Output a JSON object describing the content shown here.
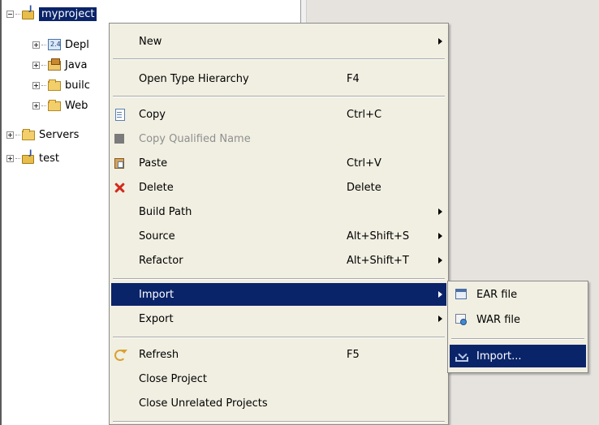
{
  "tree": {
    "items": [
      {
        "label": "myproject",
        "icon": "java-project-icon",
        "expander": "minus",
        "selected": true
      },
      {
        "label": "Depl",
        "icon": "deployment-descriptor-icon",
        "expander": "plus"
      },
      {
        "label": "Java",
        "icon": "java-resources-icon",
        "expander": "plus"
      },
      {
        "label": "builc",
        "icon": "folder-icon",
        "expander": "plus"
      },
      {
        "label": "Web",
        "icon": "folder-icon",
        "expander": "plus"
      },
      {
        "label": "Servers",
        "icon": "folder-icon",
        "expander": "plus"
      },
      {
        "label": "test",
        "icon": "java-project-icon",
        "expander": "plus"
      }
    ]
  },
  "context_menu": {
    "items": [
      {
        "label": "New",
        "accel": "",
        "submenu": true
      },
      {
        "label": "Open Type Hierarchy",
        "accel": "F4"
      },
      {
        "label": "Copy",
        "accel": "Ctrl+C",
        "icon": "copy-icon"
      },
      {
        "label": "Copy Qualified Name",
        "accel": "",
        "disabled": true,
        "icon": "copy-qualified-name-icon"
      },
      {
        "label": "Paste",
        "accel": "Ctrl+V",
        "icon": "paste-icon"
      },
      {
        "label": "Delete",
        "accel": "Delete",
        "icon": "delete-icon"
      },
      {
        "label": "Build Path",
        "accel": "",
        "submenu": true
      },
      {
        "label": "Source",
        "accel": "Alt+Shift+S",
        "submenu": true
      },
      {
        "label": "Refactor",
        "accel": "Alt+Shift+T",
        "submenu": true
      },
      {
        "label": "Import",
        "accel": "",
        "submenu": true,
        "highlighted": true
      },
      {
        "label": "Export",
        "accel": "",
        "submenu": true
      },
      {
        "label": "Refresh",
        "accel": "F5",
        "icon": "refresh-icon"
      },
      {
        "label": "Close Project",
        "accel": ""
      },
      {
        "label": "Close Unrelated Projects",
        "accel": ""
      }
    ]
  },
  "import_submenu": {
    "items": [
      {
        "label": "EAR file",
        "icon": "ear-file-icon"
      },
      {
        "label": "WAR file",
        "icon": "war-file-icon"
      },
      {
        "label": "Import...",
        "icon": "import-wizard-icon",
        "highlighted": true
      }
    ]
  },
  "colors": {
    "selection": "#0a246a",
    "menu_background": "#f1efe2",
    "pane_background": "#e6e3de"
  }
}
